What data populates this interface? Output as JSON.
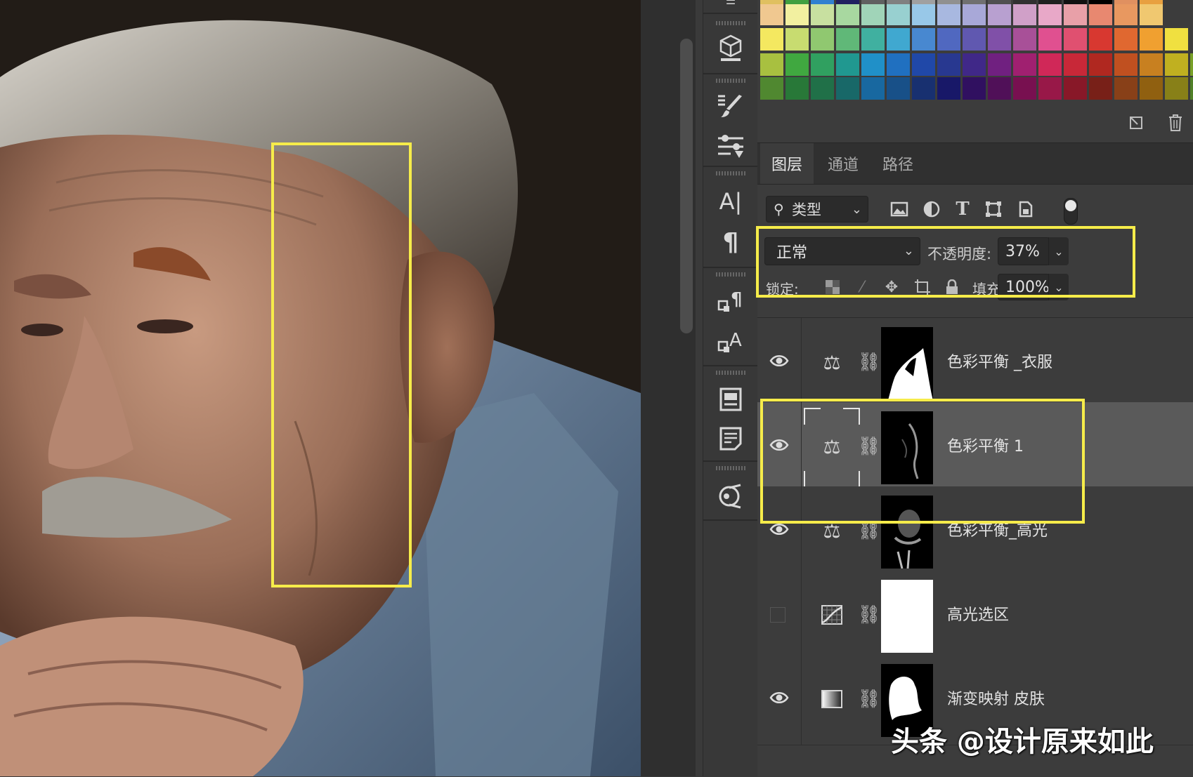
{
  "canvas": {
    "description_icon": "portrait-photo",
    "highlight_color": "#f6ec4a"
  },
  "tools": [
    {
      "name": "3d-object-icon"
    },
    {
      "name": "brush-preset-icon"
    },
    {
      "name": "adjustment-sliders-icon"
    },
    {
      "name": "character-icon",
      "glyph": "A|"
    },
    {
      "name": "paragraph-icon",
      "glyph": "¶"
    },
    {
      "name": "paragraph-style-icon"
    },
    {
      "name": "character-style-icon"
    },
    {
      "name": "libraries-icon"
    },
    {
      "name": "notes-icon"
    },
    {
      "name": "properties-icon"
    }
  ],
  "panel_tabs": [
    {
      "label": "图层",
      "active": true
    },
    {
      "label": "通道",
      "active": false
    },
    {
      "label": "路径",
      "active": false
    }
  ],
  "filter": {
    "kind_label": "类型",
    "icons": [
      "image-filter-icon",
      "adjustment-filter-icon",
      "type-filter-icon",
      "shape-filter-icon",
      "smart-object-filter-icon"
    ]
  },
  "blend": {
    "mode": "正常",
    "opacity_label": "不透明度:",
    "opacity_value": "37%"
  },
  "lock": {
    "label": "锁定:",
    "fill_label": "填充:",
    "fill_value": "100%"
  },
  "layers": [
    {
      "name": "色彩平衡 _衣服",
      "visible": true,
      "type": "color-balance",
      "selected": false
    },
    {
      "name": "色彩平衡 1",
      "visible": true,
      "type": "color-balance",
      "selected": true
    },
    {
      "name": "色彩平衡_高光",
      "visible": true,
      "type": "color-balance",
      "selected": false
    },
    {
      "name": "高光选区",
      "visible": false,
      "type": "curves",
      "selected": false
    },
    {
      "name": "渐变映射 皮肤",
      "visible": true,
      "type": "gradient-map",
      "selected": false
    }
  ],
  "watermark": "头条 @设计原来如此",
  "swatch_colors": [
    [
      "#f0c890",
      "#f2f0a0",
      "#c8e0a0",
      "#a8d8a0",
      "#a0d4b8",
      "#98d0d0",
      "#98c8e8",
      "#a8b8e0",
      "#a8a8d8",
      "#b8a0d0",
      "#d0a0c8",
      "#e8a8c8",
      "#e8a0a8",
      "#e88870",
      "#e89860",
      "#f0c870"
    ],
    [
      "#f4e860",
      "#c8dc70",
      "#90c870",
      "#60b878",
      "#40b0a0",
      "#40a8d0",
      "#4888d0",
      "#5068c0",
      "#6058b0",
      "#8050a8",
      "#a85098",
      "#e05090",
      "#e05070",
      "#d83830",
      "#e06830",
      "#f0a030",
      "#f0e040"
    ],
    [
      "#a8c040",
      "#40a840",
      "#30a060",
      "#209890",
      "#2090c8",
      "#2070c0",
      "#2048a8",
      "#283890",
      "#402888",
      "#702080",
      "#a02070",
      "#d02858",
      "#c82838",
      "#b02820",
      "#c05020",
      "#c88020",
      "#c0b020",
      "#78a028"
    ],
    [
      "#508830",
      "#287838",
      "#207048",
      "#186868",
      "#1868a0",
      "#185088",
      "#183070",
      "#181868",
      "#301060",
      "#501058",
      "#781050",
      "#981848",
      "#881828",
      "#782018",
      "#884018",
      "#906010",
      "#888018",
      "#508028"
    ]
  ]
}
